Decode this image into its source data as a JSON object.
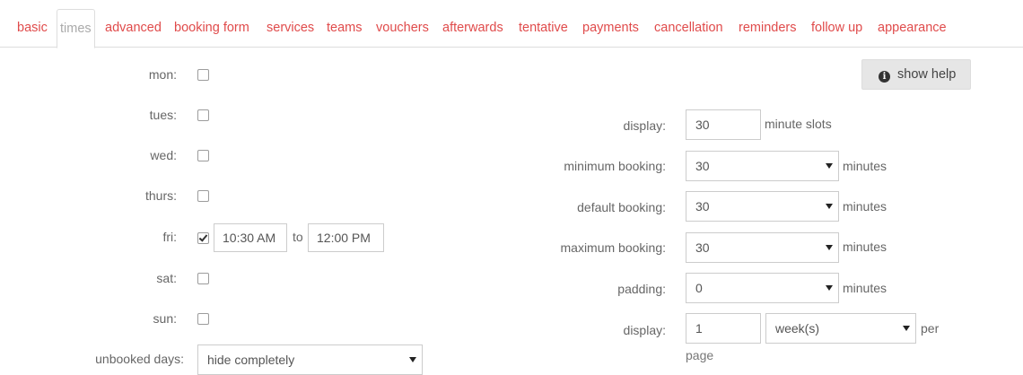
{
  "tabs": [
    {
      "label": "basic"
    },
    {
      "label": "times",
      "active": true
    },
    {
      "label": "advanced"
    },
    {
      "label": "booking form"
    },
    {
      "label": "services"
    },
    {
      "label": "teams"
    },
    {
      "label": "vouchers"
    },
    {
      "label": "afterwards"
    },
    {
      "label": "tentative"
    },
    {
      "label": "payments"
    },
    {
      "label": "cancellation"
    },
    {
      "label": "reminders"
    },
    {
      "label": "follow up"
    },
    {
      "label": "appearance"
    }
  ],
  "days": [
    {
      "label": "mon:",
      "checked": false
    },
    {
      "label": "tues:",
      "checked": false
    },
    {
      "label": "wed:",
      "checked": false
    },
    {
      "label": "thurs:",
      "checked": false
    },
    {
      "label": "fri:",
      "checked": true,
      "from": "10:30 AM",
      "to_label": "to",
      "to": "12:00 PM"
    },
    {
      "label": "sat:",
      "checked": false
    },
    {
      "label": "sun:",
      "checked": false
    }
  ],
  "unbooked": {
    "label": "unbooked days:",
    "value": "hide completely"
  },
  "help_button": {
    "label": "show help",
    "icon": "info-icon"
  },
  "settings": {
    "display_slots": {
      "label": "display:",
      "value": "30",
      "unit": "minute slots"
    },
    "minimum_booking": {
      "label": "minimum booking:",
      "value": "30",
      "unit": "minutes"
    },
    "default_booking": {
      "label": "default booking:",
      "value": "30",
      "unit": "minutes"
    },
    "maximum_booking": {
      "label": "maximum booking:",
      "value": "30",
      "unit": "minutes"
    },
    "padding": {
      "label": "padding:",
      "value": "0",
      "unit": "minutes"
    },
    "display_per_page": {
      "label": "display:",
      "value": "1",
      "period": "week(s)",
      "unit": "per",
      "unit2": "page"
    }
  }
}
